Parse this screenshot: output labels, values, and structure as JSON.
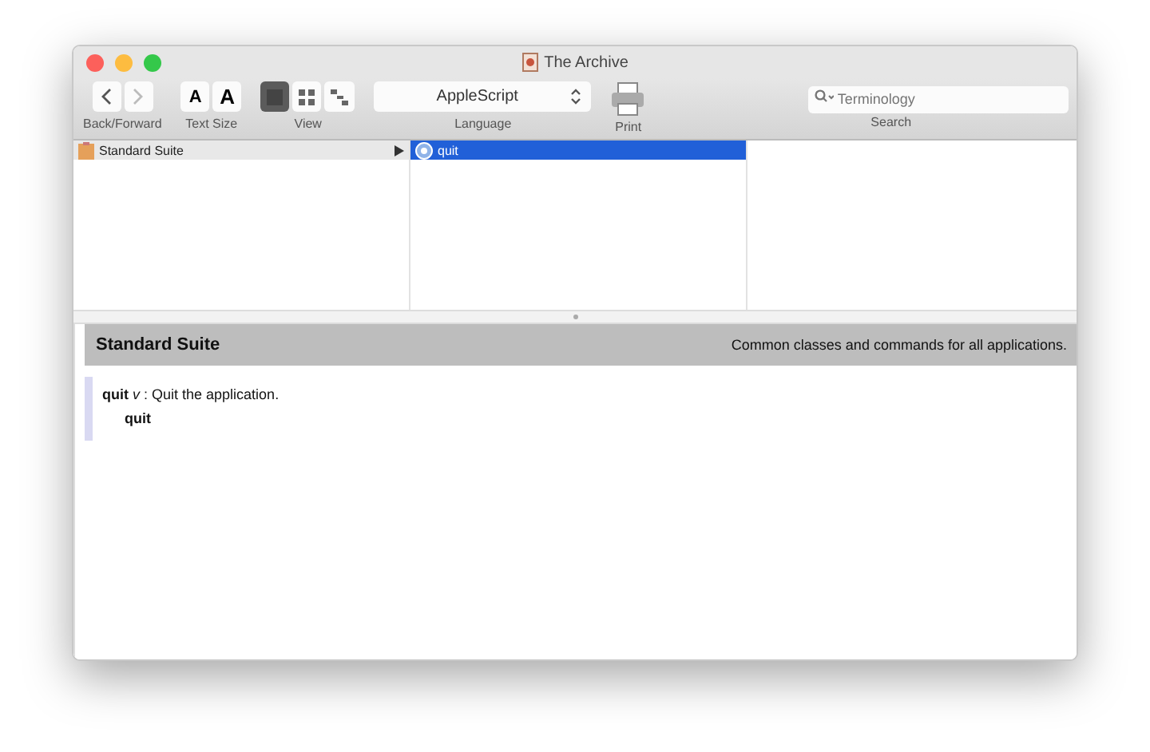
{
  "window": {
    "title": "The Archive"
  },
  "toolbar": {
    "nav_label": "Back/Forward",
    "text_size": {
      "label": "Text Size",
      "buttons": [
        "A",
        "A"
      ]
    },
    "view": {
      "label": "View",
      "buttons": [
        {
          "kind": "list",
          "selected": true
        },
        {
          "kind": "grid",
          "selected": false
        },
        {
          "kind": "tree",
          "selected": false
        }
      ]
    },
    "language": {
      "label": "Language",
      "value": "AppleScript"
    },
    "print": {
      "label": "Print"
    },
    "search": {
      "label": "Search",
      "placeholder": "Terminology"
    }
  },
  "browser": {
    "columns": [
      [
        {
          "label": "Standard Suite",
          "kind": "suite",
          "selected": false,
          "has_children": true
        }
      ],
      [
        {
          "label": "quit",
          "kind": "command",
          "selected": true,
          "has_children": false
        }
      ],
      []
    ]
  },
  "detail": {
    "title": "Standard Suite",
    "description": "Common classes and commands for all applications.",
    "entries": [
      {
        "definition": "**quit** *v* : Quit the application.",
        "syntax": "quit"
      }
    ]
  }
}
